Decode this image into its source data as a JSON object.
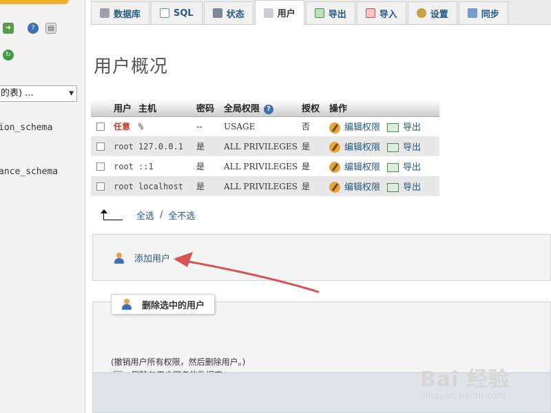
{
  "sidebar": {
    "db_select_value": "的表) ...",
    "databases": [
      "ion_schema",
      "ance_schema"
    ]
  },
  "tabs": [
    {
      "label": "数据库",
      "icon": "database-icon",
      "active": false
    },
    {
      "label": "SQL",
      "icon": "sql-icon",
      "active": false
    },
    {
      "label": "状态",
      "icon": "status-icon",
      "active": false
    },
    {
      "label": "用户",
      "icon": "users-icon",
      "active": true
    },
    {
      "label": "导出",
      "icon": "export-icon",
      "active": false
    },
    {
      "label": "导入",
      "icon": "import-icon",
      "active": false
    },
    {
      "label": "设置",
      "icon": "settings-icon",
      "active": false
    },
    {
      "label": "同步",
      "icon": "sync-icon",
      "active": false
    }
  ],
  "main": {
    "title": "用户概况",
    "table": {
      "headers": {
        "user": "用户",
        "host": "主机",
        "password": "密码",
        "privileges": "全局权限",
        "grant": "授权",
        "action": "操作"
      },
      "rows": [
        {
          "user": "任意",
          "host": "%",
          "password": "--",
          "privileges": "USAGE",
          "grant": "否",
          "edit": "编辑权限",
          "export": "导出"
        },
        {
          "user": "root",
          "host": "127.0.0.1",
          "password": "是",
          "privileges": "ALL PRIVILEGES",
          "grant": "是",
          "edit": "编辑权限",
          "export": "导出"
        },
        {
          "user": "root",
          "host": "::1",
          "password": "是",
          "privileges": "ALL PRIVILEGES",
          "grant": "是",
          "edit": "编辑权限",
          "export": "导出"
        },
        {
          "user": "root",
          "host": "localhost",
          "password": "是",
          "privileges": "ALL PRIVILEGES",
          "grant": "是",
          "edit": "编辑权限",
          "export": "导出"
        }
      ]
    },
    "select_all": "全选",
    "separator": "/",
    "deselect_all": "全不选",
    "add_user": "添加用户",
    "delete_legend": "删除选中的用户",
    "delete_note": "(撤销用户所有权限，然后删除用户。)",
    "drop_db_label": "删除与用户同名的数据库。"
  },
  "watermark": {
    "main": "Bai 经验",
    "sub": "jingyan.baidu.com"
  },
  "colors": {
    "link": "#235a81",
    "annotation_arrow": "#d9534f",
    "any_user": "#c0392b"
  }
}
